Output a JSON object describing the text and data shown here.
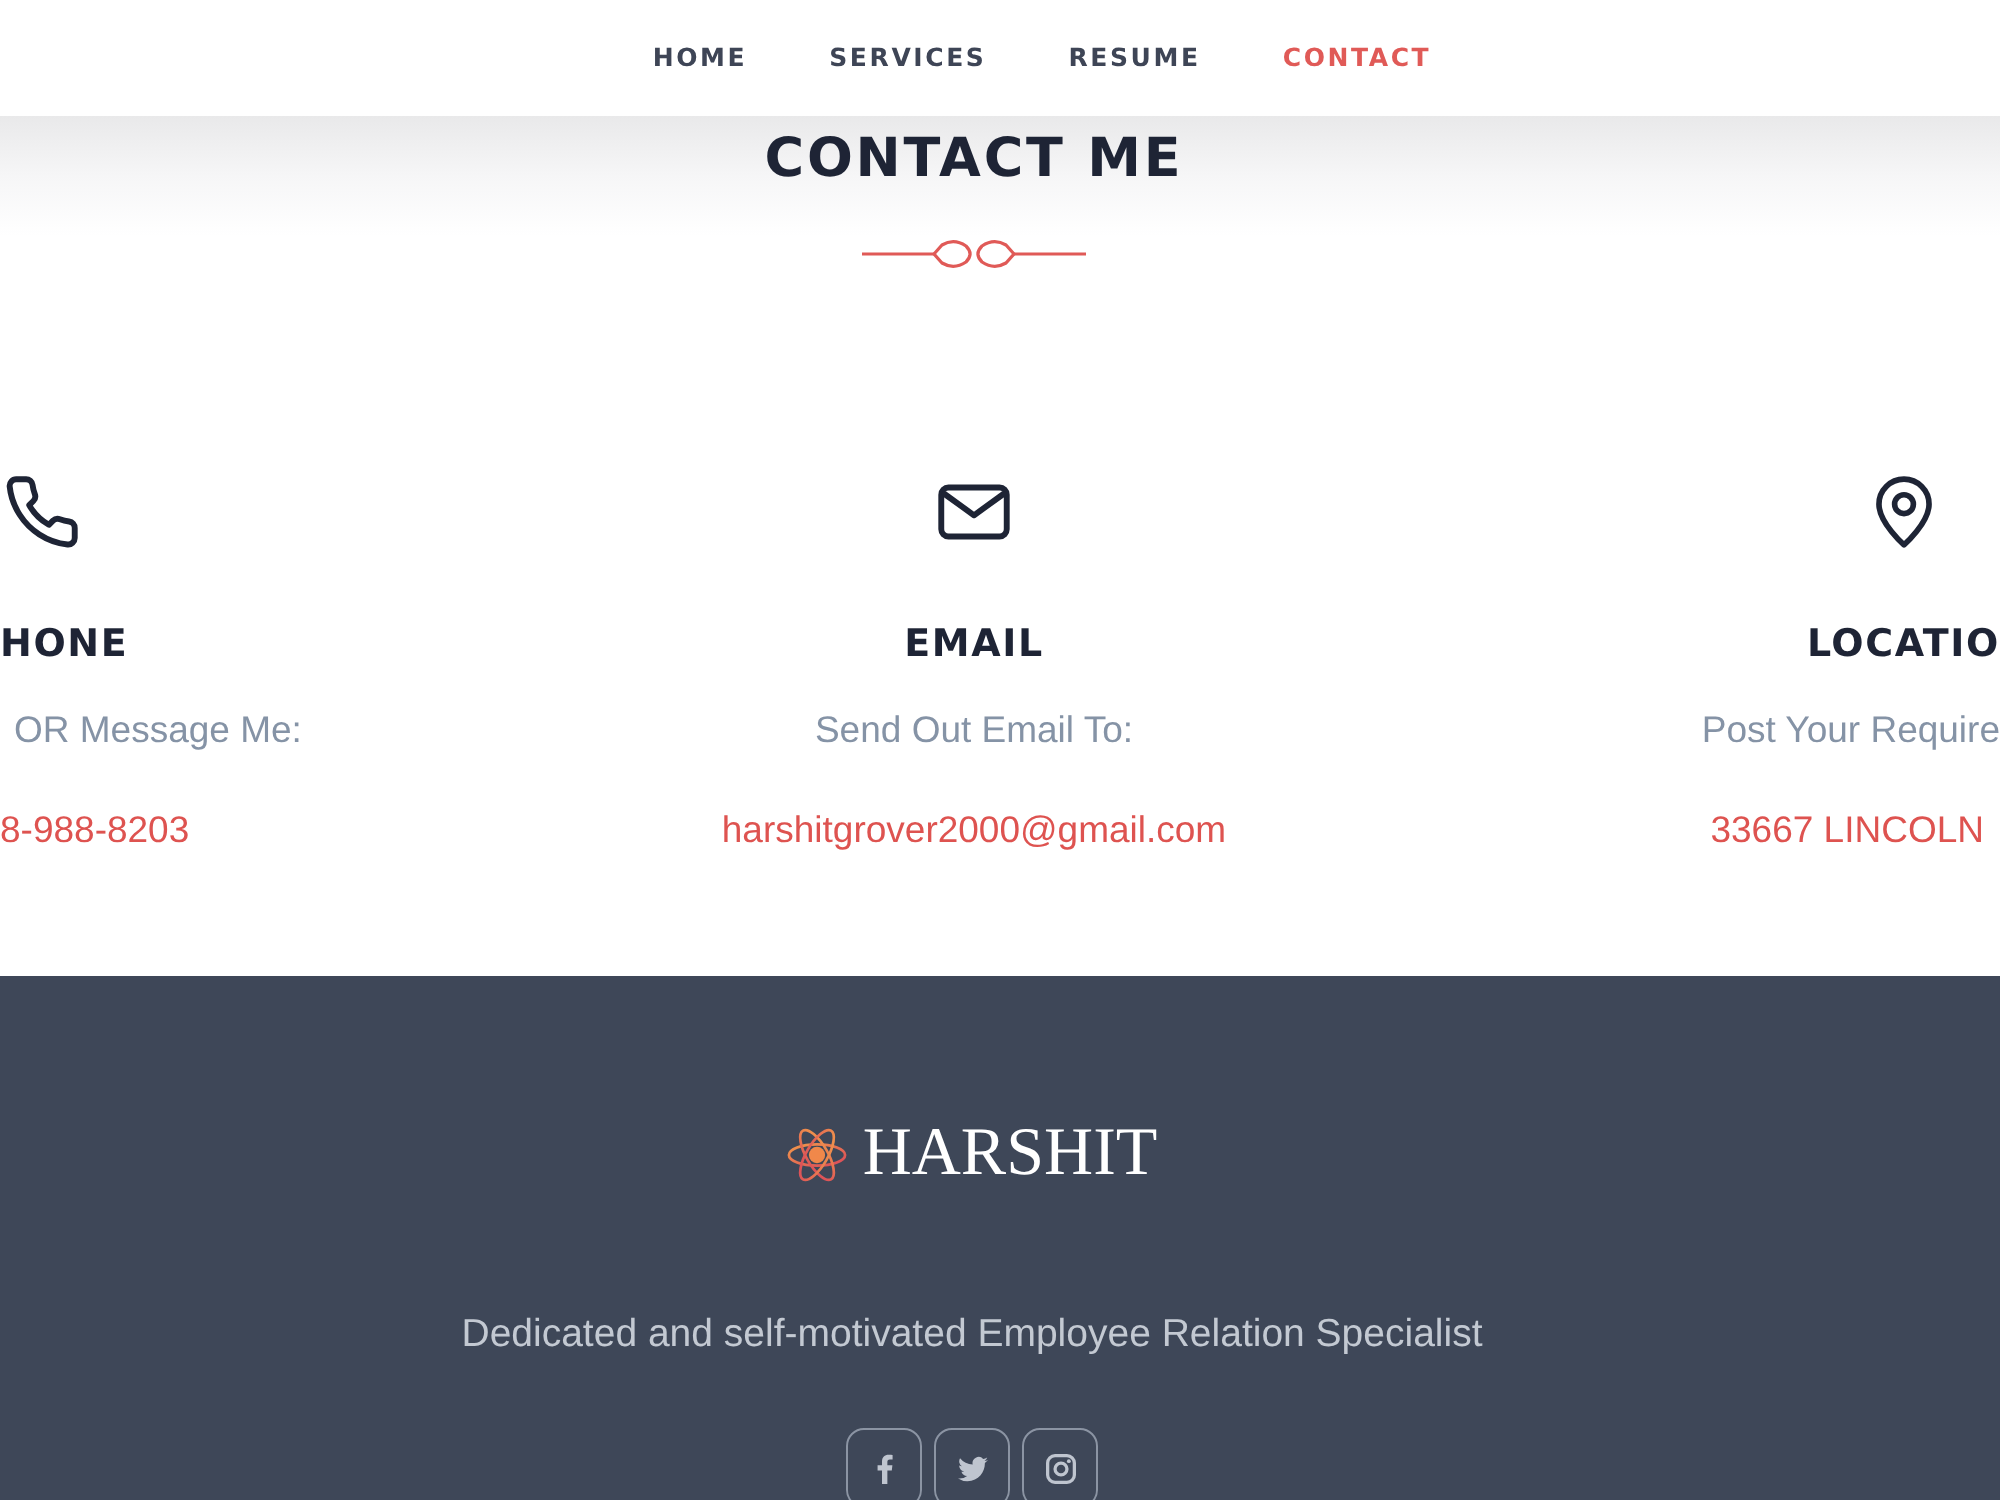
{
  "nav": {
    "items": [
      {
        "label": "HOME",
        "selected": false
      },
      {
        "label": "SERVICES",
        "selected": false
      },
      {
        "label": "RESUME",
        "selected": false
      },
      {
        "label": "CONTACT",
        "selected": true
      }
    ]
  },
  "section": {
    "title": "CONTACT ME"
  },
  "contacts": [
    {
      "kind": "phone",
      "title": "HONE",
      "subtitle": "OR Message Me:",
      "value": "8-988-8203"
    },
    {
      "kind": "email",
      "title": "EMAIL",
      "subtitle": "Send Out Email To:",
      "value": "harshitgrover2000@gmail.com"
    },
    {
      "kind": "location",
      "title": "LOCATIO",
      "subtitle": "Post Your Require",
      "value": "33667 LINCOLN"
    }
  ],
  "footer": {
    "logo": "HARSHIT",
    "tagline": "Dedicated and self-motivated Employee Relation Specialist",
    "social": [
      {
        "kind": "facebook"
      },
      {
        "kind": "twitter"
      },
      {
        "kind": "instagram"
      }
    ]
  }
}
